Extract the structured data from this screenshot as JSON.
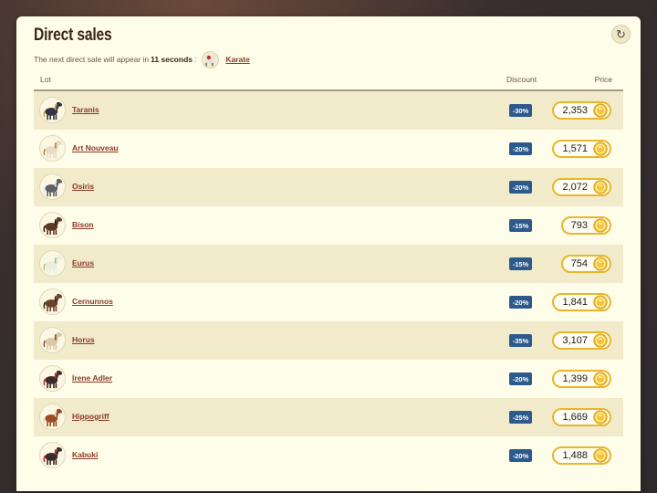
{
  "header": {
    "title": "Direct sales",
    "refresh_icon": "refresh-icon"
  },
  "notice": {
    "prefix": "The next direct sale will appear in",
    "time": "11 seconds",
    "suffix": ":",
    "next_horse": "Karate"
  },
  "table": {
    "columns": {
      "lot": "Lot",
      "discount": "Discount",
      "price": "Price"
    },
    "rows": [
      {
        "name": "Taranis",
        "discount": "-30%",
        "price": "2,353",
        "coat": "#2f3440",
        "accent": "#c9a24a"
      },
      {
        "name": "Art Nouveau",
        "discount": "-20%",
        "price": "1,571",
        "coat": "#e7ddc6",
        "accent": "#b08a55"
      },
      {
        "name": "Osiris",
        "discount": "-20%",
        "price": "2,072",
        "coat": "#5c6068",
        "accent": "#e8e8e8"
      },
      {
        "name": "Bison",
        "discount": "-15%",
        "price": "793",
        "coat": "#5a3a24",
        "accent": "#2a1a10"
      },
      {
        "name": "Eurus",
        "discount": "-15%",
        "price": "754",
        "coat": "#e9ede2",
        "accent": "#a9c46a"
      },
      {
        "name": "Cernunnos",
        "discount": "-20%",
        "price": "1,841",
        "coat": "#6b4428",
        "accent": "#3b2616"
      },
      {
        "name": "Horus",
        "discount": "-35%",
        "price": "3,107",
        "coat": "#d9c9a8",
        "accent": "#7a5a34"
      },
      {
        "name": "Irene Adler",
        "discount": "-20%",
        "price": "1,399",
        "coat": "#3a2a28",
        "accent": "#c0283a"
      },
      {
        "name": "Hippogriff",
        "discount": "-25%",
        "price": "1,669",
        "coat": "#9a4a24",
        "accent": "#e0d8c8"
      },
      {
        "name": "Kabuki",
        "discount": "-20%",
        "price": "1,488",
        "coat": "#3a2c2a",
        "accent": "#b8282a"
      }
    ]
  },
  "colors": {
    "panel_bg": "#fefde9",
    "stripe_bg": "#f1ebcc",
    "badge_bg": "#2d5a8c",
    "link": "#8b3a2a",
    "price_border": "#e8b62b"
  },
  "icons": {
    "currency": "gold-coin-icon",
    "horse": "horse-icon"
  }
}
